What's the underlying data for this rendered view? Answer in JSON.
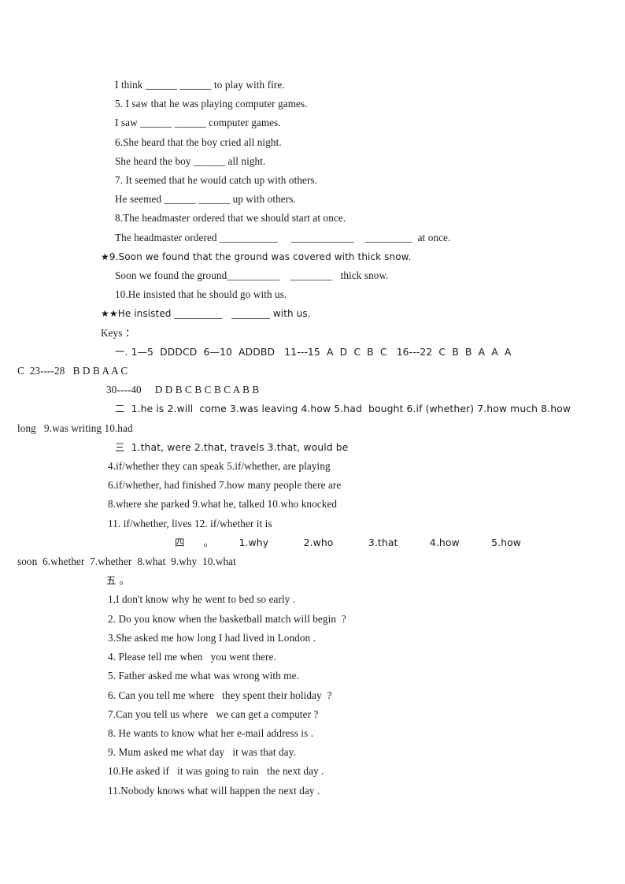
{
  "document": {
    "background_color": "#ffffff",
    "text_color": "#1a1a1a",
    "exercise_lines": [
      "I think ______ ______ to play with fire.",
      "5. I saw that he was playing computer games.",
      "I saw ______ ______ computer games.",
      "6.She heard that the boy cried all night.",
      "She heard the boy ______ all night.",
      "7. It seemed that he would catch up with others.",
      "He seemed ______ ______ up with others.",
      "8.The headmaster ordered that we should start at once.",
      "The headmaster ordered ___________     ____________    _________  at once."
    ],
    "starred_line_9": "★9.Soon we found that the ground was covered with thick snow.",
    "line_9_answer": "Soon we found the ground__________    ________   thick snow.",
    "line_10": "10.He insisted that he should go with us.",
    "starred_line_10": "★★He insisted __________   ________ with us.",
    "keys_heading": "Keys ：",
    "keys": {
      "section_1_label": "一",
      "section_1_line_1": "一. 1—5  DDDCD  6—10  ADDBD   11---15  A  D  C  B  C   16---22  C  B  B  A  A  A",
      "section_1_line_2": "C  23----28   B D B A A C",
      "section_1_line_3": "30----40     D D B C B C B C A B B",
      "section_2_label": "二",
      "section_2_line_1": "二  1.he is 2.will  come 3.was leaving 4.how 5.had  bought 6.if (whether) 7.how much 8.how",
      "section_2_line_2": "long   9.was writing 10.had",
      "section_3_label": "三",
      "section_3_line_1": "三  1.that, were 2.that, travels 3.that, would be",
      "section_3_line_2": "4.if/whether they can speak 5.if/whether, are playing",
      "section_3_line_3": "6.if/whether, had finished 7.how many people there are",
      "section_3_line_4": "8.where she parked 9.what he, talked 10.who knocked",
      "section_3_line_5": "11. if/whether, lives 12. if/whether it is",
      "section_4_label": "四",
      "section_4_line_1": "四      。        1.why           2.who           3.that          4.how          5.how",
      "section_4_line_2": "soon  6.whether  7.whether  8.what  9.why  10.what",
      "section_5_label": "五",
      "section_5_heading": "五 。"
    },
    "section_5_items": [
      "1.I don't know why he went to bed so early .",
      "2. Do you know when the basketball match will begin  ?",
      "3.She asked me how long I had lived in London .",
      "4. Please tell me when   you went there.",
      "5. Father asked me what was wrong with me.",
      "6. Can you tell me where   they spent their holiday  ?",
      "7.Can you tell us where   we can get a computer ?",
      "8. He wants to know what her e-mail address is .",
      "9. Mum asked me what day   it was that day.",
      "10.He asked if   it was going to rain   the next day .",
      "11.Nobody knows what will happen the next day ."
    ]
  }
}
